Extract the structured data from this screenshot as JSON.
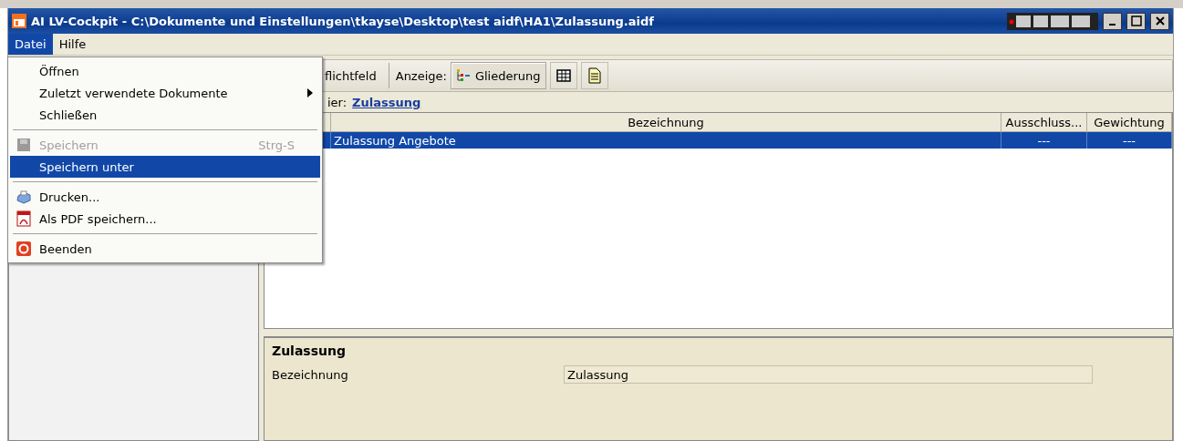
{
  "window": {
    "title": "AI LV-Cockpit - C:\\Dokumente und Einstellungen\\tkayse\\Desktop\\test aidf\\HA1\\Zulassung.aidf"
  },
  "menu_bar": [
    {
      "label": "Datei",
      "selected": true
    },
    {
      "label": "Hilfe",
      "selected": false
    }
  ],
  "open_menu": [
    {
      "kind": "item",
      "label": "Öffnen",
      "disabled": false,
      "selected": false
    },
    {
      "kind": "submenu",
      "label": "Zuletzt verwendete Dokumente",
      "disabled": false,
      "selected": false
    },
    {
      "kind": "item",
      "label": "Schließen",
      "disabled": false,
      "selected": false
    },
    {
      "kind": "separator"
    },
    {
      "kind": "item",
      "label": "Speichern",
      "shortcut": "Strg-S",
      "disabled": true,
      "selected": false
    },
    {
      "kind": "item",
      "label": "Speichern unter",
      "disabled": false,
      "selected": true
    },
    {
      "kind": "separator"
    },
    {
      "kind": "item",
      "label": "Drucken...",
      "disabled": false,
      "selected": false
    },
    {
      "kind": "item",
      "label": "Als PDF speichern...",
      "disabled": false,
      "selected": false
    },
    {
      "kind": "separator"
    },
    {
      "kind": "item",
      "label": "Beenden",
      "disabled": false,
      "selected": false
    }
  ],
  "toolbar": {
    "field_button": "flichtfeld",
    "view_label": "Anzeige:",
    "views": [
      {
        "label": "Gliederung",
        "selected": true
      },
      {
        "selected": false
      },
      {
        "selected": false
      }
    ]
  },
  "breadcrumb": {
    "label": "ier:",
    "link": "Zulassung"
  },
  "table": {
    "columns": [
      "Bezeichnung",
      "Ausschluss...",
      "Gewichtung"
    ],
    "rows": [
      {
        "cells": [
          "Zulassung Angebote",
          "---",
          "---"
        ],
        "selected": true
      }
    ]
  },
  "detail": {
    "title": "Zulassung",
    "fields": [
      {
        "label": "Bezeichnung",
        "value": "Zulassung"
      }
    ]
  }
}
